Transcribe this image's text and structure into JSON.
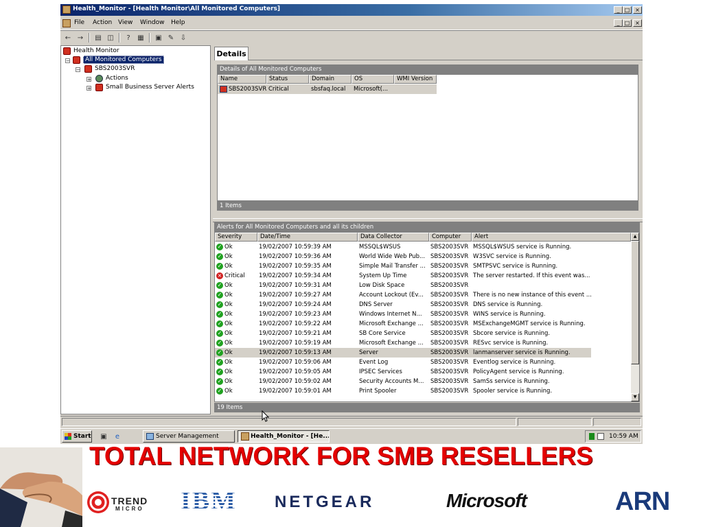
{
  "window": {
    "title": "Health_Monitor - [Health Monitor\\All Monitored Computers]",
    "controls": [
      "_",
      "□",
      "×"
    ]
  },
  "menu": [
    "File",
    "Action",
    "View",
    "Window",
    "Help"
  ],
  "tree": {
    "root": "Health Monitor",
    "selected": "All Monitored Computers",
    "server": "SBS2003SVR",
    "actions": "Actions",
    "alerts": "Small Business Server Alerts"
  },
  "details": {
    "tab": "Details",
    "group_title": "Details of All Monitored Computers",
    "columns": [
      "Name",
      "Status",
      "Domain",
      "OS",
      "WMI Version"
    ],
    "rows": [
      [
        "SBS2003SVR",
        "Critical",
        "sbsfaq.local",
        "Microsoft(...",
        ""
      ]
    ],
    "footer": "1 Items"
  },
  "alerts": {
    "group_title": "Alerts for All Monitored Computers and all its children",
    "columns": [
      "Severity",
      "Date/Time",
      "Data Collector",
      "Computer",
      "Alert"
    ],
    "rows": [
      [
        "Ok",
        "19/02/2007 10:59:39 AM",
        "MSSQL$WSUS",
        "SBS2003SVR",
        "MSSQL$WSUS service is Running."
      ],
      [
        "Ok",
        "19/02/2007 10:59:36 AM",
        "World Wide Web Pub...",
        "SBS2003SVR",
        "W3SVC service is Running."
      ],
      [
        "Ok",
        "19/02/2007 10:59:35 AM",
        "Simple Mail Transfer ...",
        "SBS2003SVR",
        "SMTPSVC service is Running."
      ],
      [
        "Critical",
        "19/02/2007 10:59:34 AM",
        "System Up Time",
        "SBS2003SVR",
        "The server restarted. If this event was..."
      ],
      [
        "Ok",
        "19/02/2007 10:59:31 AM",
        "Low Disk Space",
        "SBS2003SVR",
        ""
      ],
      [
        "Ok",
        "19/02/2007 10:59:27 AM",
        "Account Lockout (Ev...",
        "SBS2003SVR",
        "There is no new instance of this event ..."
      ],
      [
        "Ok",
        "19/02/2007 10:59:24 AM",
        "DNS Server",
        "SBS2003SVR",
        "DNS service is Running."
      ],
      [
        "Ok",
        "19/02/2007 10:59:23 AM",
        "Windows Internet N...",
        "SBS2003SVR",
        "WINS service is Running."
      ],
      [
        "Ok",
        "19/02/2007 10:59:22 AM",
        "Microsoft Exchange ...",
        "SBS2003SVR",
        "MSExchangeMGMT service is Running."
      ],
      [
        "Ok",
        "19/02/2007 10:59:21 AM",
        "SB Core Service",
        "SBS2003SVR",
        "Sbcore service is Running."
      ],
      [
        "Ok",
        "19/02/2007 10:59:19 AM",
        "Microsoft Exchange ...",
        "SBS2003SVR",
        "RESvc service is Running."
      ],
      [
        "Ok",
        "19/02/2007 10:59:13 AM",
        "Server",
        "SBS2003SVR",
        "lanmanserver service is Running."
      ],
      [
        "Ok",
        "19/02/2007 10:59:06 AM",
        "Event Log",
        "SBS2003SVR",
        "Eventlog service is Running."
      ],
      [
        "Ok",
        "19/02/2007 10:59:05 AM",
        "IPSEC Services",
        "SBS2003SVR",
        "PolicyAgent service is Running."
      ],
      [
        "Ok",
        "19/02/2007 10:59:02 AM",
        "Security Accounts M...",
        "SBS2003SVR",
        "SamSs service is Running."
      ],
      [
        "Ok",
        "19/02/2007 10:59:01 AM",
        "Print Spooler",
        "SBS2003SVR",
        "Spooler service is Running."
      ]
    ],
    "selected_row": 11,
    "footer": "19 Items"
  },
  "taskbar": {
    "start": "Start",
    "items": [
      "Server Management",
      "Health_Monitor - [He..."
    ],
    "clock": "10:59 AM"
  },
  "banner": "TOTAL NETWORK FOR SMB RESELLERS",
  "logos": {
    "trend_top": "TREND",
    "trend_bottom": "MICRO",
    "ibm": "IBM",
    "netgear": "NETGEAR",
    "microsoft": "Microsoft",
    "arn": "ARN"
  },
  "colors": {
    "titlebar": "#0a246a",
    "banner": "#e30000",
    "ok": "#21a121",
    "critical": "#d02020",
    "ibm": "#2f5fa8",
    "netgear": "#1a2a5c",
    "arn": "#1a3a7a"
  }
}
